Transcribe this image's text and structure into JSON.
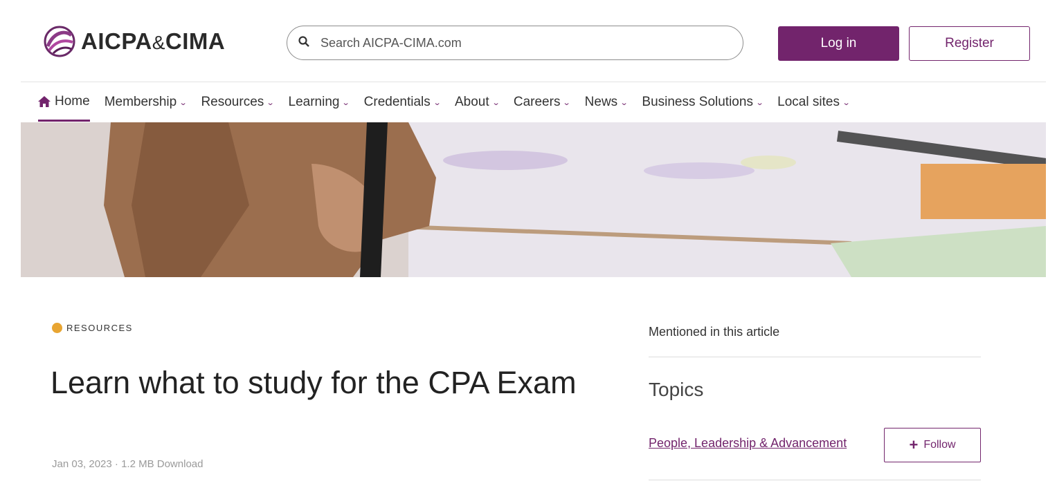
{
  "header": {
    "logo": {
      "text_left": "AICPA",
      "text_amp": "&",
      "text_right": "CIMA"
    },
    "search": {
      "placeholder": "Search AICPA-CIMA.com",
      "icon": "search-icon"
    },
    "login_label": "Log in",
    "register_label": "Register"
  },
  "nav": {
    "items": [
      {
        "label": "Home",
        "icon": "home-icon",
        "active": true
      },
      {
        "label": "Membership"
      },
      {
        "label": "Resources"
      },
      {
        "label": "Learning"
      },
      {
        "label": "Credentials"
      },
      {
        "label": "About"
      },
      {
        "label": "Careers"
      },
      {
        "label": "News"
      },
      {
        "label": "Business Solutions"
      },
      {
        "label": "Local sites"
      }
    ]
  },
  "article": {
    "kicker": "RESOURCES",
    "title": "Learn what to study for the CPA Exam",
    "meta": "Jan 03, 2023 · 1.2 MB Download"
  },
  "sidebar": {
    "heading": "Mentioned in this article",
    "topics_heading": "Topics",
    "topic": "People, Leadership & Advancement",
    "follow_label": "Follow"
  },
  "colors": {
    "brand": "#72246c",
    "kicker_icon": "#e8a532",
    "meta_text": "#9a9a9a"
  }
}
